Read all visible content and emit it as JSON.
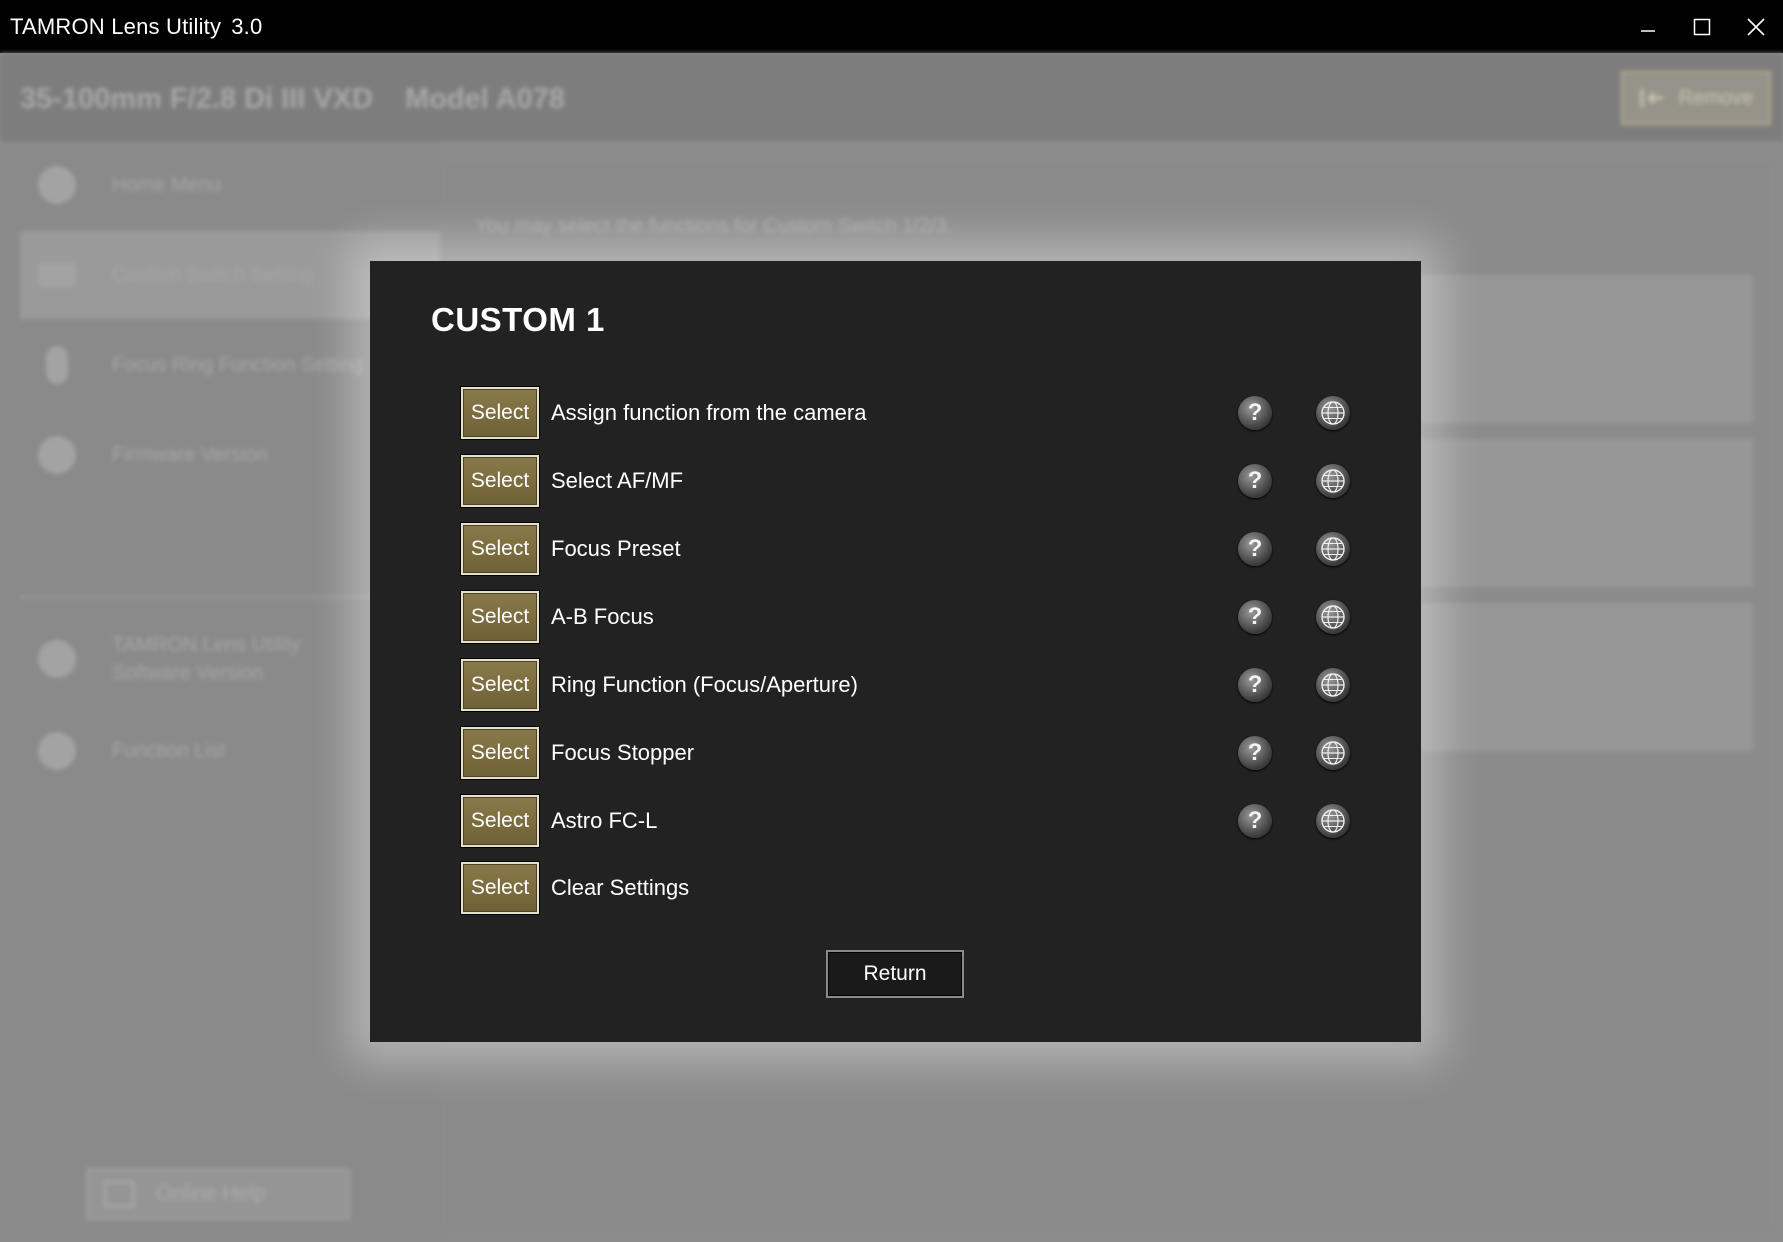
{
  "window": {
    "title": "TAMRON Lens Utility",
    "version": "3.0"
  },
  "lens": {
    "name": "35-100mm F/2.8 Di III VXD",
    "model": "Model A078",
    "remove_label": "Remove"
  },
  "sidebar": {
    "items": [
      {
        "label": "Home Menu",
        "icon": "home-icon"
      },
      {
        "label": "Custom Switch Setting",
        "icon": "switch-icon"
      },
      {
        "label": "Focus Ring Function Setting",
        "icon": "focus-ring-icon"
      },
      {
        "label": "Firmware Version",
        "icon": "firmware-icon"
      },
      {
        "label": "TAMRON Lens Utility",
        "label2": "Software Version",
        "icon": "info-icon"
      },
      {
        "label": "Function List",
        "icon": "question-icon"
      }
    ],
    "online_help": "Online Help"
  },
  "content": {
    "hint": "You may select the functions for Custom Switch 1/2/3."
  },
  "modal": {
    "title": "CUSTOM 1",
    "select_label": "Select",
    "return_label": "Return",
    "options": [
      {
        "label": "Assign function from the camera",
        "has_help": true
      },
      {
        "label": "Select AF/MF",
        "has_help": true
      },
      {
        "label": "Focus Preset",
        "has_help": true
      },
      {
        "label": "A-B Focus",
        "has_help": true
      },
      {
        "label": "Ring Function (Focus/Aperture)",
        "has_help": true
      },
      {
        "label": "Focus Stopper",
        "has_help": true
      },
      {
        "label": "Astro FC-L",
        "has_help": true
      },
      {
        "label": "Clear Settings",
        "has_help": false
      }
    ]
  }
}
